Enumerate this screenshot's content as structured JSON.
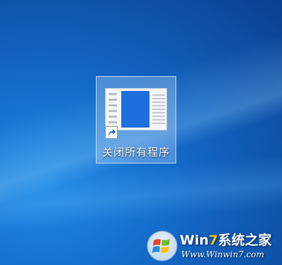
{
  "desktop": {
    "shortcut": {
      "label": "关闭所有程序",
      "icon": "window-thumbnail-icon",
      "overlay_icon": "shortcut-arrow-icon"
    }
  },
  "watermark": {
    "title_prefix": "Win",
    "title_number": "7",
    "title_suffix": "系统之家",
    "url": "Www.Winwin7.com",
    "logo_icon": "windows-logo-icon"
  },
  "colors": {
    "desktop_blue": "#1366c4",
    "selection": "#aacdf5",
    "thumbnail_blue": "#1d6fe0",
    "watermark_seven": "#f2c318"
  }
}
